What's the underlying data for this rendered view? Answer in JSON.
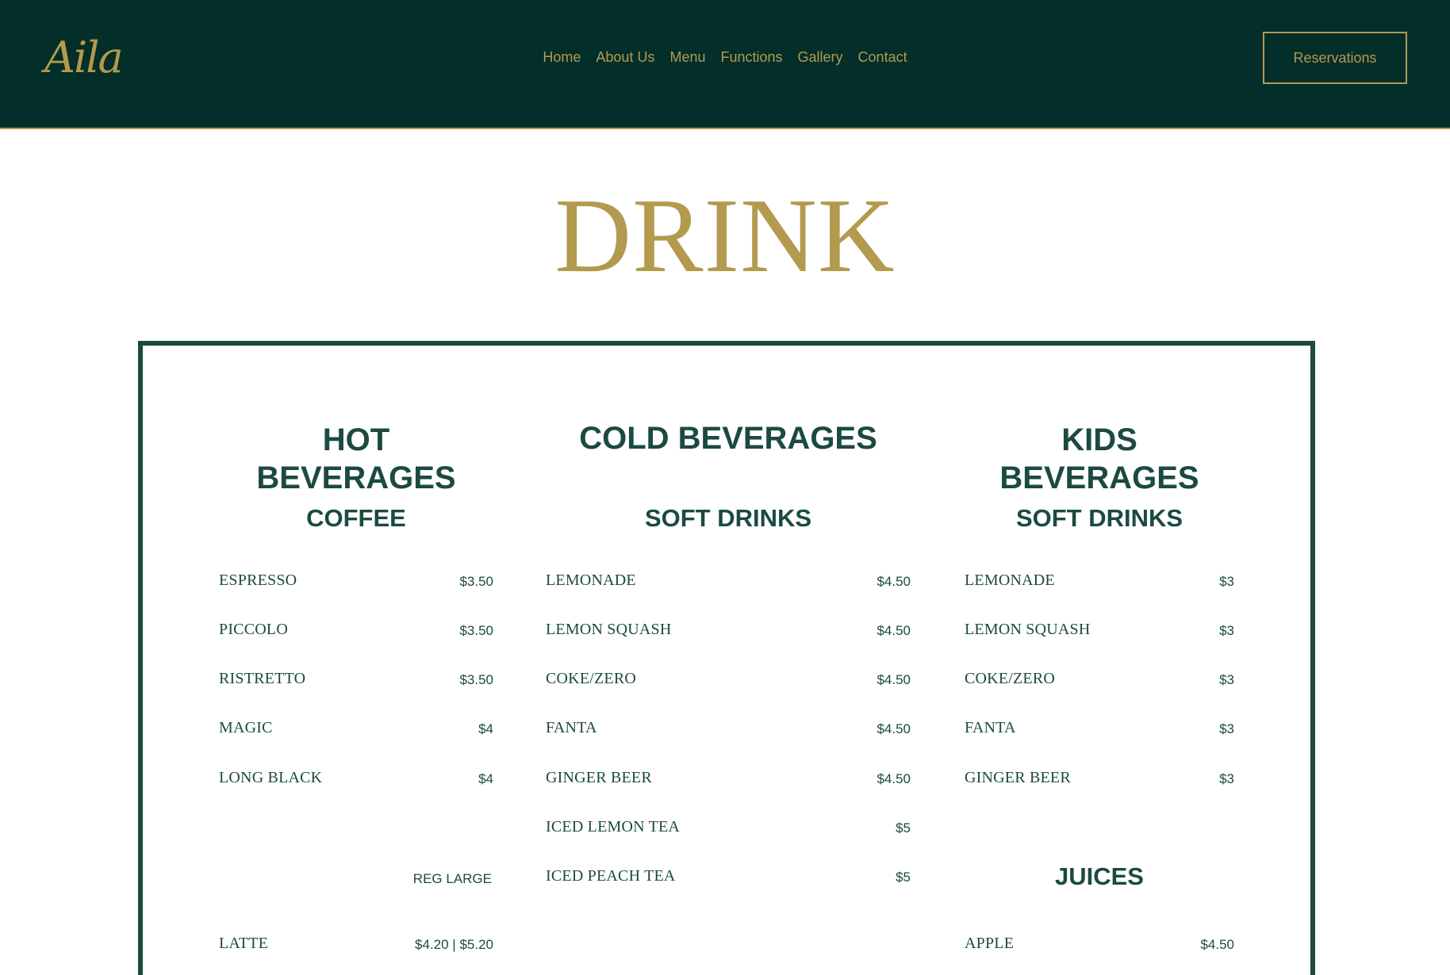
{
  "header": {
    "logo": "Aila",
    "nav": [
      "Home",
      "About Us",
      "Menu",
      "Functions",
      "Gallery",
      "Contact"
    ],
    "reservations_label": "Reservations"
  },
  "page": {
    "title": "DRINK"
  },
  "menu": {
    "hot": {
      "title": "HOT BEVERAGES",
      "section": "COFFEE",
      "items": [
        {
          "name": "ESPRESSO",
          "price": "$3.50"
        },
        {
          "name": "PICCOLO",
          "price": "$3.50"
        },
        {
          "name": "RISTRETTO",
          "price": "$3.50"
        },
        {
          "name": "MAGIC",
          "price": "$4"
        },
        {
          "name": "LONG BLACK",
          "price": "$4"
        }
      ],
      "size_header": "REG LARGE",
      "sized_items": [
        {
          "name": "LATTE",
          "price": "$4.20 | $5.20"
        }
      ]
    },
    "cold": {
      "title": "COLD BEVERAGES",
      "section": "SOFT DRINKS",
      "items": [
        {
          "name": "LEMONADE",
          "price": "$4.50"
        },
        {
          "name": "LEMON SQUASH",
          "price": "$4.50"
        },
        {
          "name": "COKE/ZERO",
          "price": "$4.50"
        },
        {
          "name": "FANTA",
          "price": "$4.50"
        },
        {
          "name": "GINGER BEER",
          "price": "$4.50"
        },
        {
          "name": "ICED LEMON TEA",
          "price": "$5"
        },
        {
          "name": "ICED PEACH TEA",
          "price": "$5"
        }
      ]
    },
    "kids": {
      "title": "KIDS BEVERAGES",
      "section": "SOFT DRINKS",
      "items": [
        {
          "name": "LEMONADE",
          "price": "$3"
        },
        {
          "name": "LEMON SQUASH",
          "price": "$3"
        },
        {
          "name": "COKE/ZERO",
          "price": "$3"
        },
        {
          "name": "FANTA",
          "price": "$3"
        },
        {
          "name": "GINGER BEER",
          "price": "$3"
        }
      ],
      "section2": "JUICES",
      "items2": [
        {
          "name": "APPLE",
          "price": "$4.50"
        }
      ]
    }
  }
}
